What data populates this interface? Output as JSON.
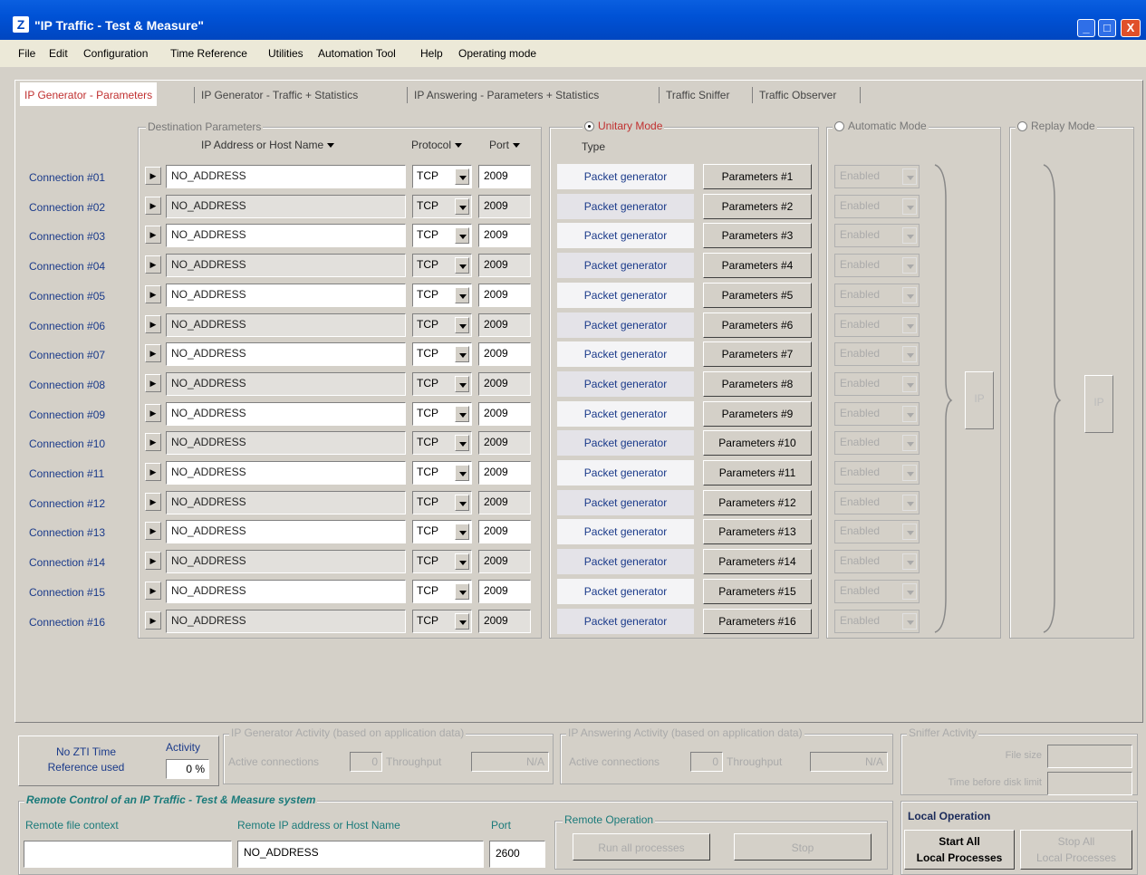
{
  "window": {
    "title": "\"IP Traffic - Test & Measure\"",
    "minimize": "_",
    "maximize": "□",
    "close": "X"
  },
  "menu": [
    "File",
    "Edit",
    "Configuration",
    "Time Reference",
    "Utilities",
    "Automation Tool",
    "Help",
    "Operating mode"
  ],
  "tabs": [
    "IP Generator - Parameters",
    "IP Generator - Traffic + Statistics",
    "IP Answering - Parameters + Statistics",
    "Traffic Sniffer",
    "Traffic Observer"
  ],
  "dest": {
    "group_label": "Destination Parameters",
    "col_address": "IP Address or Host Name",
    "col_protocol": "Protocol",
    "col_port": "Port"
  },
  "unitary": {
    "label": "Unitary Mode",
    "type_header": "Type"
  },
  "automatic": {
    "label": "Automatic Mode",
    "ip_label": "IP"
  },
  "replay": {
    "label": "Replay Mode",
    "ip_label": "IP"
  },
  "connections": [
    {
      "label": "Connection #01",
      "address": "NO_ADDRESS",
      "protocol": "TCP",
      "port": "2009",
      "type": "Packet generator",
      "params": "Parameters #1",
      "auto": "Enabled"
    },
    {
      "label": "Connection #02",
      "address": "NO_ADDRESS",
      "protocol": "TCP",
      "port": "2009",
      "type": "Packet generator",
      "params": "Parameters #2",
      "auto": "Enabled"
    },
    {
      "label": "Connection #03",
      "address": "NO_ADDRESS",
      "protocol": "TCP",
      "port": "2009",
      "type": "Packet generator",
      "params": "Parameters #3",
      "auto": "Enabled"
    },
    {
      "label": "Connection #04",
      "address": "NO_ADDRESS",
      "protocol": "TCP",
      "port": "2009",
      "type": "Packet generator",
      "params": "Parameters #4",
      "auto": "Enabled"
    },
    {
      "label": "Connection #05",
      "address": "NO_ADDRESS",
      "protocol": "TCP",
      "port": "2009",
      "type": "Packet generator",
      "params": "Parameters #5",
      "auto": "Enabled"
    },
    {
      "label": "Connection #06",
      "address": "NO_ADDRESS",
      "protocol": "TCP",
      "port": "2009",
      "type": "Packet generator",
      "params": "Parameters #6",
      "auto": "Enabled"
    },
    {
      "label": "Connection #07",
      "address": "NO_ADDRESS",
      "protocol": "TCP",
      "port": "2009",
      "type": "Packet generator",
      "params": "Parameters #7",
      "auto": "Enabled"
    },
    {
      "label": "Connection #08",
      "address": "NO_ADDRESS",
      "protocol": "TCP",
      "port": "2009",
      "type": "Packet generator",
      "params": "Parameters #8",
      "auto": "Enabled"
    },
    {
      "label": "Connection #09",
      "address": "NO_ADDRESS",
      "protocol": "TCP",
      "port": "2009",
      "type": "Packet generator",
      "params": "Parameters #9",
      "auto": "Enabled"
    },
    {
      "label": "Connection #10",
      "address": "NO_ADDRESS",
      "protocol": "TCP",
      "port": "2009",
      "type": "Packet generator",
      "params": "Parameters #10",
      "auto": "Enabled"
    },
    {
      "label": "Connection #11",
      "address": "NO_ADDRESS",
      "protocol": "TCP",
      "port": "2009",
      "type": "Packet generator",
      "params": "Parameters #11",
      "auto": "Enabled"
    },
    {
      "label": "Connection #12",
      "address": "NO_ADDRESS",
      "protocol": "TCP",
      "port": "2009",
      "type": "Packet generator",
      "params": "Parameters #12",
      "auto": "Enabled"
    },
    {
      "label": "Connection #13",
      "address": "NO_ADDRESS",
      "protocol": "TCP",
      "port": "2009",
      "type": "Packet generator",
      "params": "Parameters #13",
      "auto": "Enabled"
    },
    {
      "label": "Connection #14",
      "address": "NO_ADDRESS",
      "protocol": "TCP",
      "port": "2009",
      "type": "Packet generator",
      "params": "Parameters #14",
      "auto": "Enabled"
    },
    {
      "label": "Connection #15",
      "address": "NO_ADDRESS",
      "protocol": "TCP",
      "port": "2009",
      "type": "Packet generator",
      "params": "Parameters #15",
      "auto": "Enabled"
    },
    {
      "label": "Connection #16",
      "address": "NO_ADDRESS",
      "protocol": "TCP",
      "port": "2009",
      "type": "Packet generator",
      "params": "Parameters #16",
      "auto": "Enabled"
    }
  ],
  "status": {
    "time_ref_line1": "No ZTI Time",
    "time_ref_line2": "Reference used",
    "activity_label": "Activity",
    "activity_value": "0 %",
    "gen_activity": {
      "label": "IP Generator Activity (based on application data)",
      "active_label": "Active connections",
      "active_value": "0",
      "throughput_label": "Throughput",
      "throughput_value": "N/A"
    },
    "ans_activity": {
      "label": "IP Answering Activity (based on application data)",
      "active_label": "Active connections",
      "active_value": "0",
      "throughput_label": "Throughput",
      "throughput_value": "N/A"
    },
    "sniffer": {
      "label": "Sniffer Activity",
      "file_size_label": "File size",
      "time_label": "Time before disk limit"
    }
  },
  "remote": {
    "group_label": "Remote Control of an IP Traffic - Test & Measure system",
    "file_context_label": "Remote file context",
    "file_context_value": "",
    "address_label": "Remote IP address or Host Name",
    "address_value": "NO_ADDRESS",
    "port_label": "Port",
    "port_value": "2600",
    "operation_label": "Remote Operation",
    "run_all": "Run all processes",
    "stop": "Stop"
  },
  "local": {
    "label": "Local Operation",
    "start_line1": "Start All",
    "start_line2": "Local Processes",
    "stop_line1": "Stop All",
    "stop_line2": "Local Processes"
  }
}
